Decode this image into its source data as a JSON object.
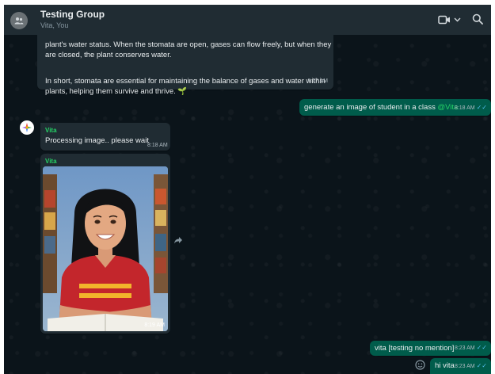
{
  "header": {
    "title": "Testing Group",
    "subtitle": "Vita, You"
  },
  "messages": [
    {
      "id": "m1",
      "direction": "incoming",
      "text_1": "plant's water status. When the stomata are open, gases can flow freely, but when they are closed, the plant conserves water.",
      "text_2": "In short, stomata are essential for maintaining the balance of gases and water within plants, helping them survive and thrive. 🌱",
      "time": "8:17 AM"
    },
    {
      "id": "m2",
      "direction": "outgoing",
      "text": "generate an image of student in a class ",
      "mention": "@Vita",
      "time": "8:18 AM"
    },
    {
      "id": "m3",
      "direction": "incoming",
      "sender": "Vita",
      "text": "Processing image.. please wait",
      "time": "8:18 AM"
    },
    {
      "id": "m4",
      "direction": "incoming",
      "sender": "Vita",
      "image": "generated-student-portrait",
      "time": "8:19 AM"
    },
    {
      "id": "m5",
      "direction": "outgoing",
      "text": "vita [testing no mention]",
      "time": "8:23 AM"
    },
    {
      "id": "m6",
      "direction": "outgoing",
      "text": "hi vita",
      "time": "8:23 AM"
    }
  ],
  "ticks": "✓✓",
  "colors": {
    "background": "#0b141a",
    "header": "#202c33",
    "incoming_bubble": "#202c33",
    "outgoing_bubble": "#005c4b",
    "accent": "#25d366",
    "read_ticks": "#53bdeb"
  }
}
